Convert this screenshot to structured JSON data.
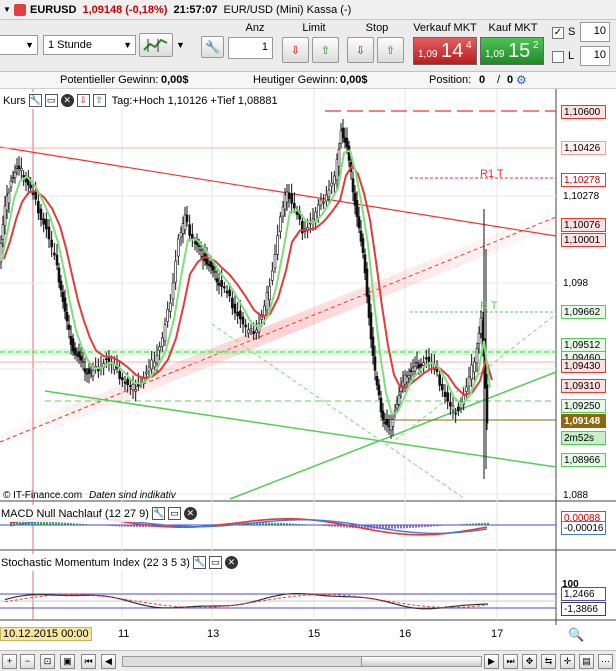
{
  "titlebar": {
    "symbol": "EURUSD",
    "price_change": "1,09148 (-0,18%)",
    "time": "21:57:07",
    "instrument": "EUR/USD (Mini) Kassa (-)"
  },
  "toolbar": {
    "period_value": "",
    "timeframe_value": "1 Stunde",
    "anz_label": "Anz",
    "anz_value": "1",
    "limit_label": "Limit",
    "stop_label": "Stop",
    "sell_label": "Verkauf MKT",
    "buy_label": "Kauf MKT",
    "sell_price": {
      "small": "1,09",
      "big": "14",
      "sup": "4"
    },
    "buy_price": {
      "small": "1,09",
      "big": "15",
      "sup": "2"
    },
    "s_label": "S",
    "l_label": "L",
    "s_value": "10",
    "l_value": "10"
  },
  "infobar": {
    "potential_label": "Potentieller Gewinn:",
    "potential_value": "0,00$",
    "today_label": "Heutiger Gewinn:",
    "today_value": "0,00$",
    "position_label": "Position:",
    "position_value": "0",
    "position_sep": "/",
    "position_value2": "0"
  },
  "main_panel": {
    "title": "Kurs",
    "range_text": "Tag:+Hoch 1,10126 +Tief 1,08881",
    "r1_label": "R1 T",
    "rt_label": "R T",
    "watermark": "© IT-Finance.com",
    "note": "Daten sind indikativ",
    "price_labels": [
      "1,10600",
      "1,10426",
      "1,10278",
      "1,102",
      "1,10076",
      "1,10001",
      "1,098",
      "1,09662",
      "1,09512",
      "1,09460",
      "1,09430",
      "1,09310",
      "1,09250",
      "1,09148",
      "2m52s",
      "1,08966",
      "1,088"
    ]
  },
  "macd_panel": {
    "title": "MACD Null Nachlauf (12 27 9)",
    "labels": [
      "0,00088",
      "-0,00016"
    ]
  },
  "stoch_panel": {
    "title": "Stochastic Momentum Index (22 3 5 3)",
    "labels": [
      "100",
      "1,2466",
      "-1,3866"
    ]
  },
  "time_axis": {
    "labels": [
      "10.12.2015 00:00",
      "11",
      "13",
      "15",
      "16",
      "17"
    ]
  },
  "colors": {
    "sell": "#c62828",
    "buy": "#2e9a33",
    "current_price": "#8b6914",
    "r_line": "#e23b3b",
    "g_line": "#56d656"
  }
}
